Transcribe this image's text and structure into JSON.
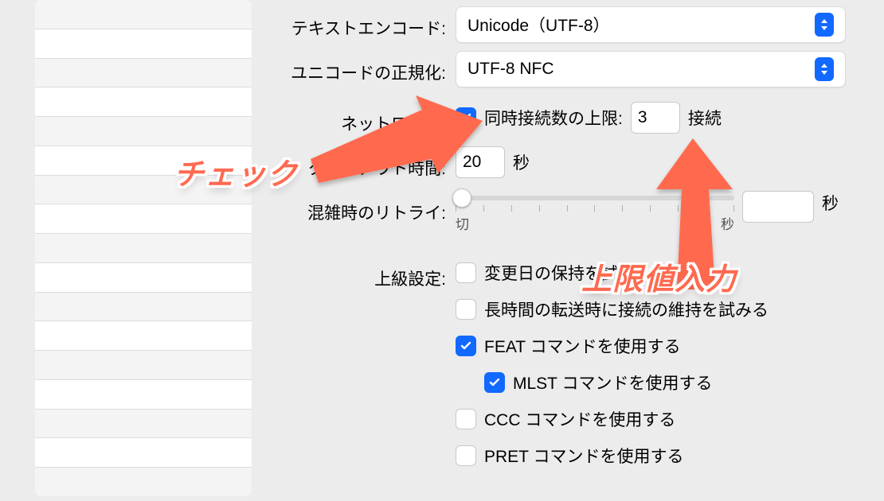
{
  "labels": {
    "text_encoding": "テキストエンコード:",
    "normalization": "ユニコードの正規化:",
    "network": "ネットワーク:",
    "timeout": "タイムアウト時間:",
    "retry": "混雑時のリトライ:",
    "advanced": "上級設定:"
  },
  "text_encoding": {
    "value": "Unicode（UTF-8）"
  },
  "normalization": {
    "value": "UTF-8 NFC"
  },
  "network": {
    "limit_checked": true,
    "limit_label_a": "同時接続数の上限:",
    "limit_value": "3",
    "limit_label_b": "接続",
    "timeout_value": "20",
    "timeout_unit": "秒",
    "retry_value": "",
    "retry_unit": "秒",
    "retry_min_label": "切",
    "retry_max_label": "秒"
  },
  "advanced": {
    "preserve_mtime": {
      "checked": false,
      "label": "変更日の保持を試みる"
    },
    "keepalive": {
      "checked": false,
      "label": "長時間の転送時に接続の維持を試みる"
    },
    "feat": {
      "checked": true,
      "label": "FEAT コマンドを使用する"
    },
    "mlst": {
      "checked": true,
      "label": "MLST コマンドを使用する"
    },
    "ccc": {
      "checked": false,
      "label": "CCC コマンドを使用する"
    },
    "pret": {
      "checked": false,
      "label": "PRET コマンドを使用する"
    }
  },
  "annotations": {
    "check": "チェック",
    "upper": "上限値入力"
  }
}
